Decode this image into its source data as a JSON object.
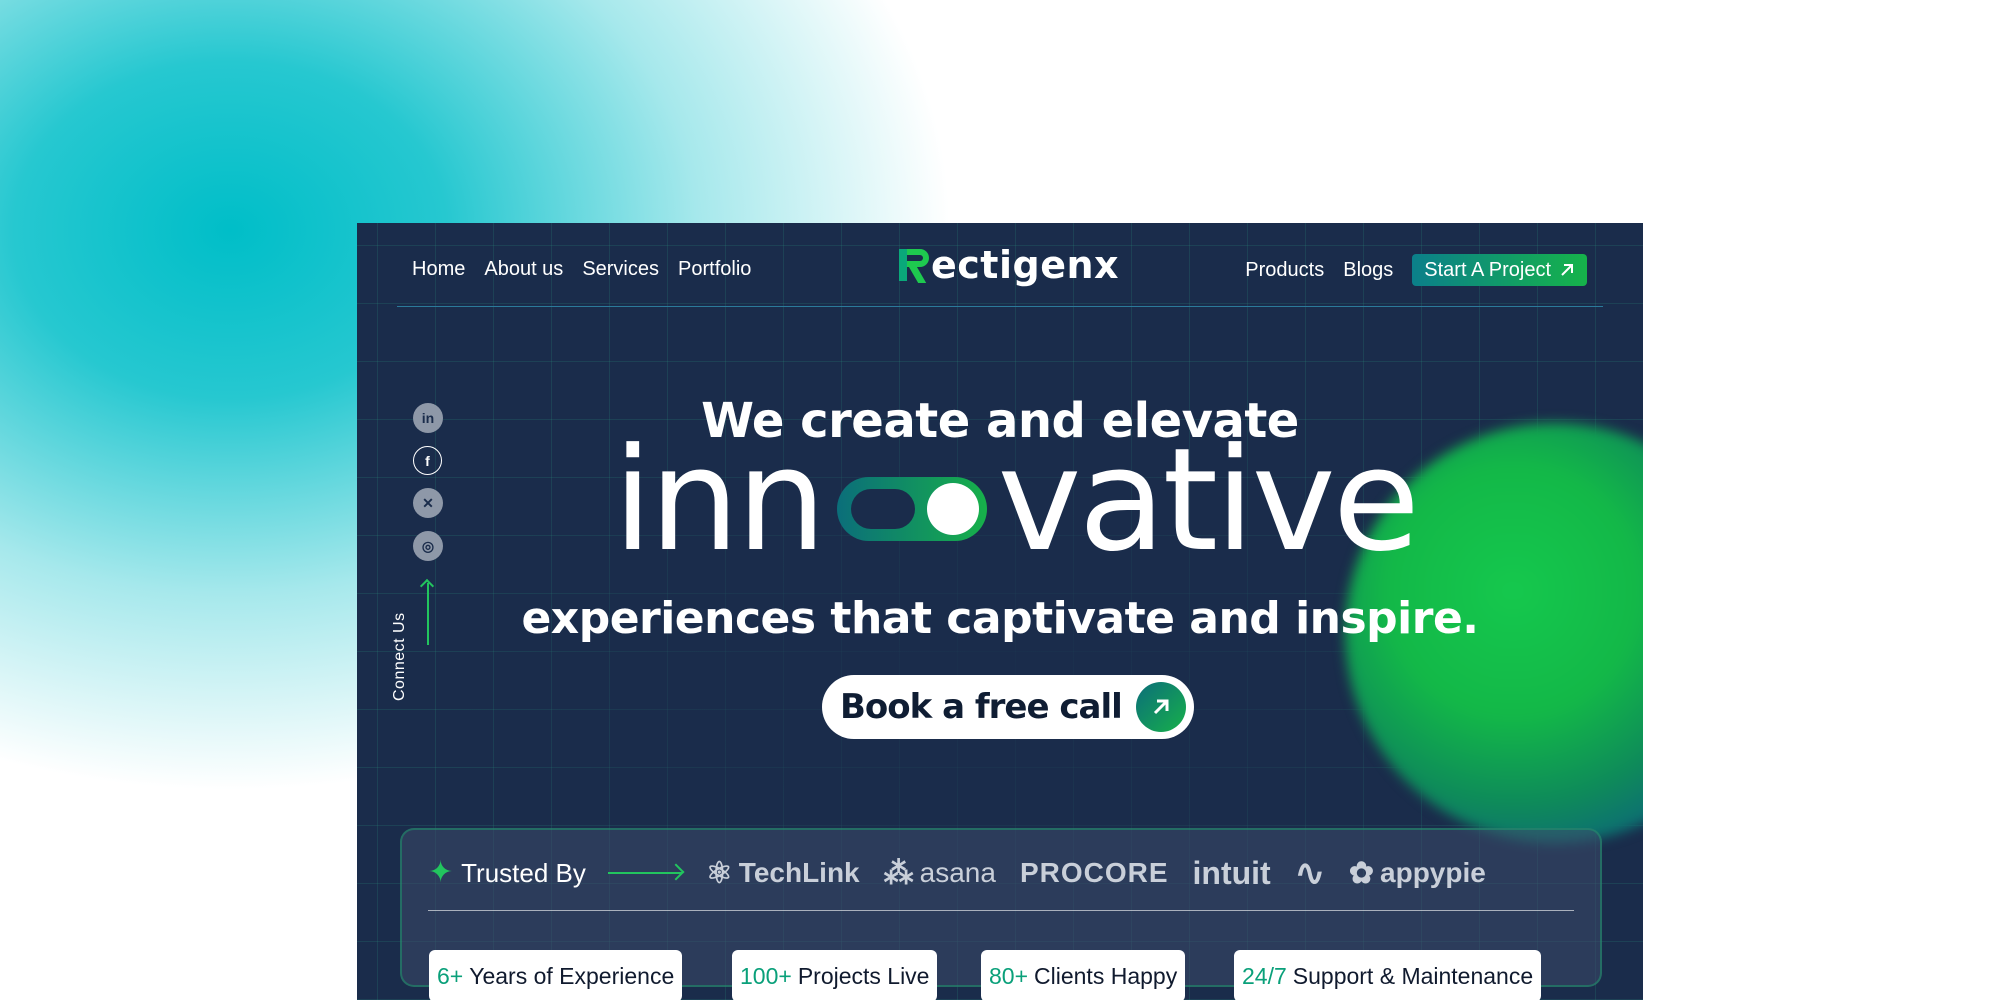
{
  "colors": {
    "page_bg": "#ffffff",
    "glow": "#00bec8",
    "frame_bg": "#1a2c4b",
    "accent_green": "#22c55e",
    "accent_teal": "#0b7f8a",
    "stat_number": "#0aa07a"
  },
  "nav": {
    "left_links": [
      "Home",
      "About us",
      "Services",
      "Portfolio"
    ],
    "logo_text": "ectigenx",
    "right_links": [
      "Products",
      "Blogs"
    ],
    "cta_label": "Start A Project",
    "cta_icon": "arrow-up-right-icon"
  },
  "social": {
    "icons": [
      "linkedin-icon",
      "facebook-icon",
      "x-icon",
      "instagram-icon"
    ],
    "glyphs": [
      "in",
      "f",
      "✕",
      "◎"
    ],
    "connect_label": "Connect Us"
  },
  "hero": {
    "line1": "We create and elevate",
    "big_left": "inn",
    "big_right": "vative",
    "line3": "experiences that captivate and inspire.",
    "button_label": "Book a free call",
    "button_icon": "arrow-up-right-icon"
  },
  "trusted": {
    "label": "Trusted By",
    "brands": [
      {
        "name": "TechLink",
        "icon": "atom-icon",
        "glyph": "⚛"
      },
      {
        "name": "asana",
        "icon": "asana-dots-icon",
        "glyph": "⁂"
      },
      {
        "name": "PROCORE",
        "icon": "",
        "glyph": ""
      },
      {
        "name": "intuit",
        "icon": "",
        "glyph": ""
      },
      {
        "name": "",
        "icon": "wave-logo-icon",
        "glyph": "∿"
      },
      {
        "name": "appypie",
        "icon": "appypie-icon",
        "glyph": "✿"
      }
    ]
  },
  "stats": [
    {
      "number": "6+",
      "label": "Years of Experience"
    },
    {
      "number": "100+",
      "label": "Projects Live"
    },
    {
      "number": "80+",
      "label": "Clients Happy"
    },
    {
      "number": "24/7",
      "label": "Support & Maintenance"
    }
  ]
}
